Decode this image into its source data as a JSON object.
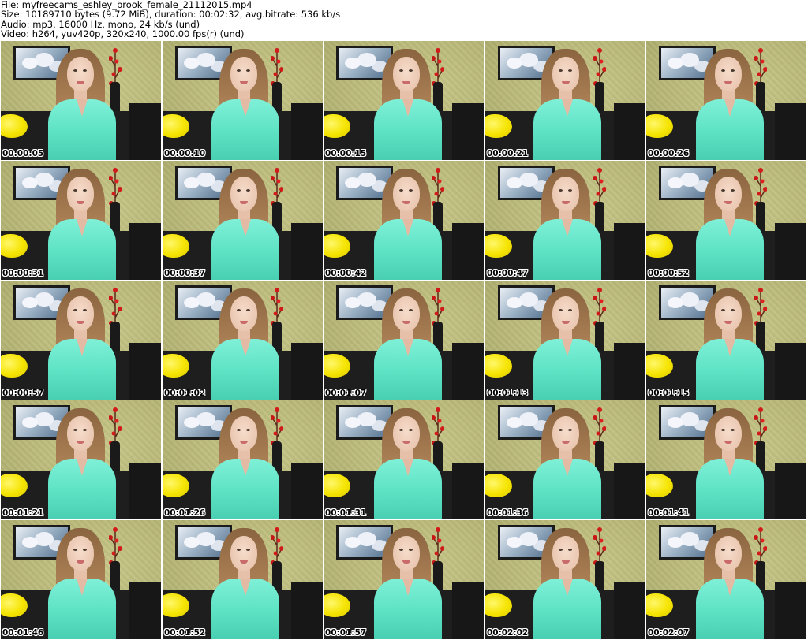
{
  "header": {
    "file_line": "File: myfreecams_eshley_brook_female_21112015.mp4",
    "size_line": "Size: 10189710 bytes (9.72 MiB), duration: 00:02:32, avg.bitrate: 536 kb/s",
    "audio_line": "Audio: mp3, 16000 Hz, mono, 24 kb/s (und)",
    "video_line": "Video: h264, yuv420p, 320x240, 1000.00 fps(r) (und)"
  },
  "thumbnails": [
    {
      "timestamp": "00:00:05"
    },
    {
      "timestamp": "00:00:10"
    },
    {
      "timestamp": "00:00:15"
    },
    {
      "timestamp": "00:00:21"
    },
    {
      "timestamp": "00:00:26"
    },
    {
      "timestamp": "00:00:31"
    },
    {
      "timestamp": "00:00:37"
    },
    {
      "timestamp": "00:00:42"
    },
    {
      "timestamp": "00:00:47"
    },
    {
      "timestamp": "00:00:52"
    },
    {
      "timestamp": "00:00:57"
    },
    {
      "timestamp": "00:01:02"
    },
    {
      "timestamp": "00:01:07"
    },
    {
      "timestamp": "00:01:13"
    },
    {
      "timestamp": "00:01:15"
    },
    {
      "timestamp": "00:01:21"
    },
    {
      "timestamp": "00:01:26"
    },
    {
      "timestamp": "00:01:31"
    },
    {
      "timestamp": "00:01:36"
    },
    {
      "timestamp": "00:01:41"
    },
    {
      "timestamp": "00:01:46"
    },
    {
      "timestamp": "00:01:52"
    },
    {
      "timestamp": "00:01:57"
    },
    {
      "timestamp": "00:02:02"
    },
    {
      "timestamp": "00:02:07"
    }
  ]
}
